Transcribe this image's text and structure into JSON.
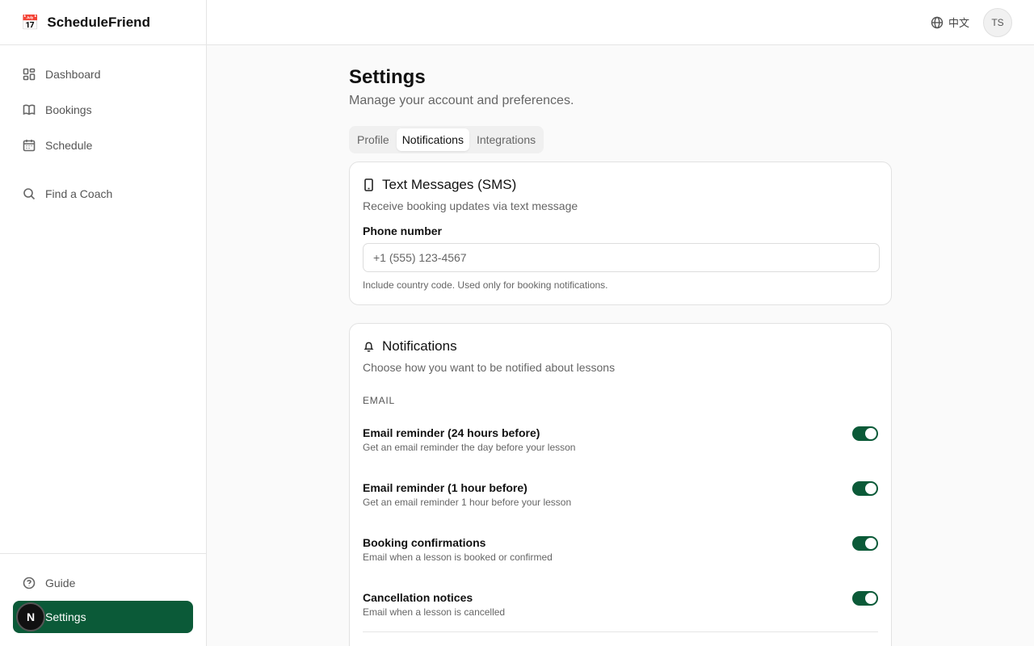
{
  "app": {
    "name": "ScheduleFriend",
    "logo_icon": "calendar-emoji-icon"
  },
  "sidebar": {
    "items": [
      {
        "label": "Dashboard",
        "icon": "dashboard-icon"
      },
      {
        "label": "Bookings",
        "icon": "book-icon"
      },
      {
        "label": "Schedule",
        "icon": "calendar-icon"
      },
      {
        "label": "Find a Coach",
        "icon": "search-icon"
      }
    ],
    "bottom": [
      {
        "label": "Guide",
        "icon": "help-circle-icon"
      },
      {
        "label": "Settings",
        "icon": "gear-icon",
        "active": true
      }
    ],
    "badge": "N"
  },
  "topbar": {
    "language": "中文",
    "avatar_initials": "TS"
  },
  "page": {
    "title": "Settings",
    "subtitle": "Manage your account and preferences."
  },
  "tabs": [
    {
      "label": "Profile",
      "active": false
    },
    {
      "label": "Notifications",
      "active": true
    },
    {
      "label": "Integrations",
      "active": false
    }
  ],
  "sms_card": {
    "title": "Text Messages (SMS)",
    "description": "Receive booking updates via text message",
    "phone_label": "Phone number",
    "phone_placeholder": "+1 (555) 123-4567",
    "phone_value": "",
    "hint": "Include country code. Used only for booking notifications."
  },
  "notifications_card": {
    "title": "Notifications",
    "description": "Choose how you want to be notified about lessons",
    "section_label": "EMAIL",
    "items": [
      {
        "title": "Email reminder (24 hours before)",
        "description": "Get an email reminder the day before your lesson",
        "enabled": true
      },
      {
        "title": "Email reminder (1 hour before)",
        "description": "Get an email reminder 1 hour before your lesson",
        "enabled": true
      },
      {
        "title": "Booking confirmations",
        "description": "Email when a lesson is booked or confirmed",
        "enabled": true
      },
      {
        "title": "Cancellation notices",
        "description": "Email when a lesson is cancelled",
        "enabled": true
      }
    ]
  },
  "colors": {
    "accent": "#0b5a38",
    "border": "#e5e5e5",
    "muted_text": "#666666"
  }
}
